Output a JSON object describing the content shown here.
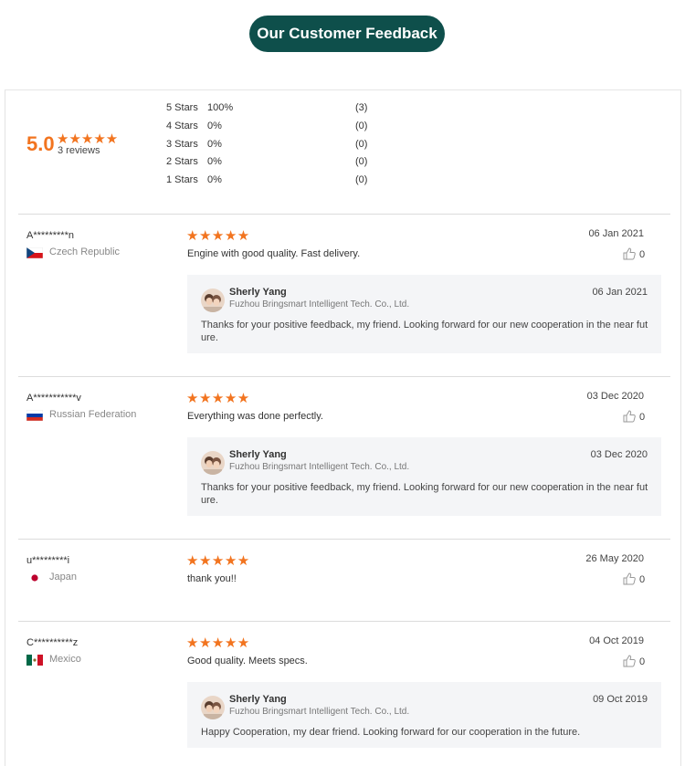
{
  "header": {
    "title": "Our Customer Feedback"
  },
  "summary": {
    "score": "5.0",
    "stars": "★★★★★",
    "review_count": "3 reviews",
    "distribution": [
      {
        "label": "5 Stars",
        "percent": "100%",
        "count": "(3)"
      },
      {
        "label": "4 Stars",
        "percent": "0%",
        "count": "(0)"
      },
      {
        "label": "3 Stars",
        "percent": "0%",
        "count": "(0)"
      },
      {
        "label": "2 Stars",
        "percent": "0%",
        "count": "(0)"
      },
      {
        "label": "1 Stars",
        "percent": "0%",
        "count": "(0)"
      }
    ]
  },
  "colors": {
    "accent": "#f2741f",
    "title_bg": "#0e4f4b",
    "reply_bg": "#f4f5f7"
  },
  "reviews": [
    {
      "name": "A*********n",
      "country": "Czech Republic",
      "flag": "czech-flag-icon",
      "stars": "★★★★★",
      "rating": 5,
      "comment": "Engine with good quality. Fast delivery.",
      "date": "06 Jan 2021",
      "likes": "0",
      "reply": {
        "name": "Sherly Yang",
        "company": "Fuzhou Bringsmart Intelligent Tech. Co., Ltd.",
        "date": "06 Jan 2021",
        "text": "Thanks for your positive feedback, my friend. Looking forward for our new cooperation in the near future."
      }
    },
    {
      "name": "A***********v",
      "country": "Russian Federation",
      "flag": "russia-flag-icon",
      "stars": "★★★★★",
      "rating": 5,
      "comment": "Everything was done perfectly.",
      "date": "03 Dec 2020",
      "likes": "0",
      "reply": {
        "name": "Sherly Yang",
        "company": "Fuzhou Bringsmart Intelligent Tech. Co., Ltd.",
        "date": "03 Dec 2020",
        "text": "Thanks for your positive feedback, my friend. Looking forward for our new cooperation in the near future."
      }
    },
    {
      "name": "u*********i",
      "country": "Japan",
      "flag": "japan-flag-icon",
      "stars": "★★★★★",
      "rating": 5,
      "comment": "thank you!!",
      "date": "26 May 2020",
      "likes": "0"
    },
    {
      "name": "C**********z",
      "country": "Mexico",
      "flag": "mexico-flag-icon",
      "stars": "★★★★★",
      "rating": 5,
      "comment": "Good quality. Meets specs.",
      "date": "04 Oct 2019",
      "likes": "0",
      "reply": {
        "name": "Sherly Yang",
        "company": "Fuzhou Bringsmart Intelligent Tech. Co., Ltd.",
        "date": "09 Oct 2019",
        "text": "Happy Cooperation, my dear friend. Looking forward for our cooperation in the future."
      }
    }
  ]
}
